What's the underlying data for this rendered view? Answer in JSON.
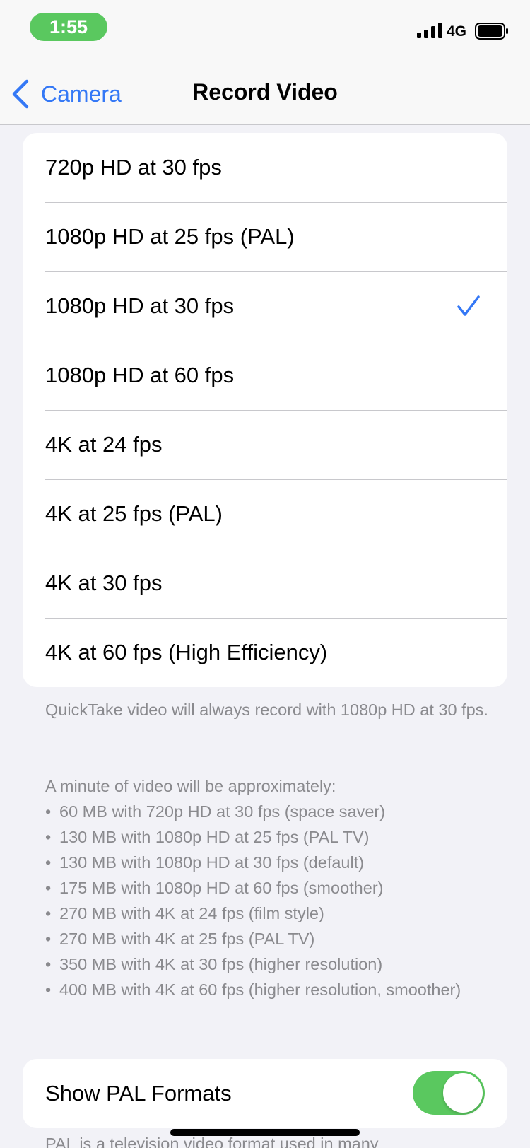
{
  "status_bar": {
    "time": "1:55",
    "network": "4G",
    "icons": [
      "signal-icon",
      "battery-icon"
    ]
  },
  "nav": {
    "back_label": "Camera",
    "title": "Record Video",
    "icons": [
      "chevron-left-icon"
    ]
  },
  "options": [
    {
      "label": "720p HD at 30 fps",
      "selected": false
    },
    {
      "label": "1080p HD at 25 fps (PAL)",
      "selected": false
    },
    {
      "label": "1080p HD at 30 fps",
      "selected": true
    },
    {
      "label": "1080p HD at 60 fps",
      "selected": false
    },
    {
      "label": "4K at 24 fps",
      "selected": false
    },
    {
      "label": "4K at 25 fps (PAL)",
      "selected": false
    },
    {
      "label": "4K at 30 fps",
      "selected": false
    },
    {
      "label": "4K at 60 fps (High Efficiency)",
      "selected": false
    }
  ],
  "footer": {
    "quicktake_note": "QuickTake video will always record with 1080p HD at 30 fps.",
    "size_intro": "A minute of video will be approximately:",
    "sizes": [
      "60 MB with 720p HD at 30 fps (space saver)",
      "130 MB with 1080p HD at 25 fps (PAL TV)",
      "130 MB with 1080p HD at 30 fps (default)",
      "175 MB with 1080p HD at 60 fps (smoother)",
      "270 MB with 4K at 24 fps (film style)",
      "270 MB with 4K at 25 fps (PAL TV)",
      "350 MB with 4K at 30 fps (higher resolution)",
      "400 MB with 4K at 60 fps (higher resolution, smoother)"
    ]
  },
  "pal": {
    "label": "Show PAL Formats",
    "enabled": true,
    "description": "PAL is a television video format used in many"
  },
  "colors": {
    "accent": "#3478f6",
    "toggle_on": "#5ac85f",
    "background": "#f2f2f7",
    "footer_text": "#8a8a8e"
  }
}
